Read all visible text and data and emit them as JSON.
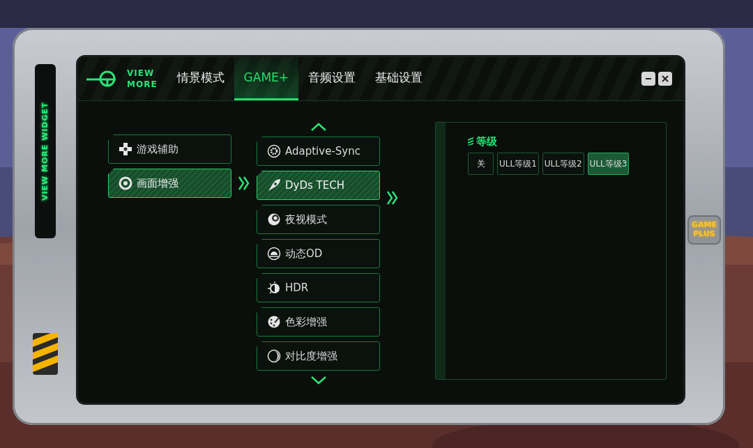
{
  "bezel": {
    "side_label": "VIEW MORE WIDGET",
    "badge_lines": [
      "GAME",
      "PLUS"
    ]
  },
  "logo": {
    "lines": [
      "VIEW",
      "MORE"
    ]
  },
  "tabs": [
    {
      "label": "情景模式",
      "selected": false
    },
    {
      "label": "GAME+",
      "selected": true
    },
    {
      "label": "音频设置",
      "selected": false
    },
    {
      "label": "基础设置",
      "selected": false
    }
  ],
  "categories": [
    {
      "label": "游戏辅助",
      "selected": false
    },
    {
      "label": "画面增强",
      "selected": true
    }
  ],
  "features": [
    {
      "label": "Adaptive-Sync",
      "selected": false
    },
    {
      "label": "DyDs TECH",
      "selected": true
    },
    {
      "label": "夜视模式",
      "selected": false
    },
    {
      "label": "动态OD",
      "selected": false
    },
    {
      "label": "HDR",
      "selected": false
    },
    {
      "label": "色彩增强",
      "selected": false
    },
    {
      "label": "对比度增强",
      "selected": false
    }
  ],
  "panel": {
    "heading": "等级",
    "options": [
      {
        "label": "关",
        "selected": false
      },
      {
        "label": "ULL等级1",
        "selected": false
      },
      {
        "label": "ULL等级2",
        "selected": false
      },
      {
        "label": "ULL等级3",
        "selected": true
      }
    ]
  }
}
